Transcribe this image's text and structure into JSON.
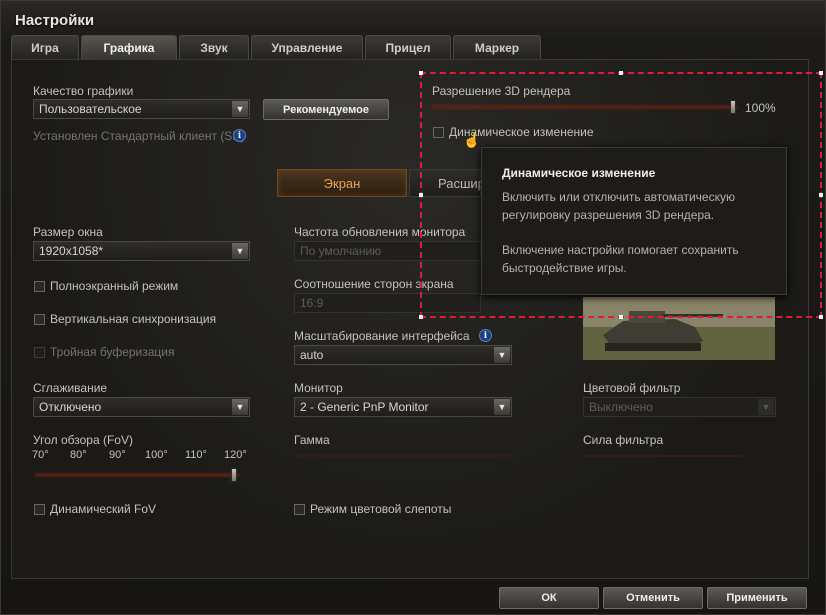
{
  "window": {
    "title": "Настройки"
  },
  "tabs": [
    "Игра",
    "Графика",
    "Звук",
    "Управление",
    "Прицел",
    "Маркер"
  ],
  "graphics_quality": {
    "label": "Качество графики",
    "value": "Пользовательское",
    "recommended_button": "Рекомендуемое",
    "client_info": "Установлен Стандартный клиент (SD)"
  },
  "render_resolution": {
    "label": "Разрешение 3D рендера",
    "percent_text": "100%",
    "value_percent": 100
  },
  "dynamic_change": {
    "label": "Динамическое изменение",
    "checked": false
  },
  "subtabs": {
    "screen": "Экран",
    "advanced": "Расшир"
  },
  "window_size": {
    "label": "Размер окна",
    "value": "1920x1058*"
  },
  "refresh_rate": {
    "label": "Частота обновления монитора",
    "value": "По умолчанию"
  },
  "aspect_ratio": {
    "label": "Соотношение сторон экрана",
    "value": "16:9"
  },
  "ui_scale": {
    "label": "Масштабирование интерфейса",
    "value": "auto"
  },
  "fullscreen": {
    "label": "Полноэкранный режим",
    "checked": false
  },
  "vsync": {
    "label": "Вертикальная синхронизация",
    "checked": false
  },
  "triple_buffering": {
    "label": "Тройная буферизация",
    "checked": false
  },
  "antialiasing": {
    "label": "Сглаживание",
    "value": "Отключено"
  },
  "monitor": {
    "label": "Монитор",
    "value": "2 - Generic PnP Monitor"
  },
  "color_filter": {
    "label": "Цветовой фильтр",
    "value": "Выключено"
  },
  "fov": {
    "label": "Угол обзора (FoV)",
    "ticks": [
      "70°",
      "80°",
      "90°",
      "100°",
      "110°",
      "120°"
    ],
    "value_deg": 120
  },
  "gamma": {
    "label": "Гамма"
  },
  "filter_strength": {
    "label": "Сила фильтра"
  },
  "dynamic_fov": {
    "label": "Динамический FoV",
    "checked": false
  },
  "colorblind": {
    "label": "Режим цветовой слепоты",
    "checked": false
  },
  "tooltip": {
    "title": "Динамическое изменение",
    "line1": "Включить или отключить автоматическую",
    "line2": "регулировку разрешения 3D рендера.",
    "line3": "Включение настройки помогает сохранить",
    "line4": "быстродействие игры."
  },
  "footer": {
    "ok": "ОК",
    "cancel": "Отменить",
    "apply": "Применить"
  },
  "colors": {
    "accent_orange": "#e8913a",
    "slider_red": "#7a2a16",
    "selection_frame": "#e01a3c",
    "info_blue": "#1f3f7a"
  },
  "icons": {
    "dropdown": "chevron-down-icon",
    "info": "info-icon",
    "cursor": "hand-pointer-icon"
  }
}
